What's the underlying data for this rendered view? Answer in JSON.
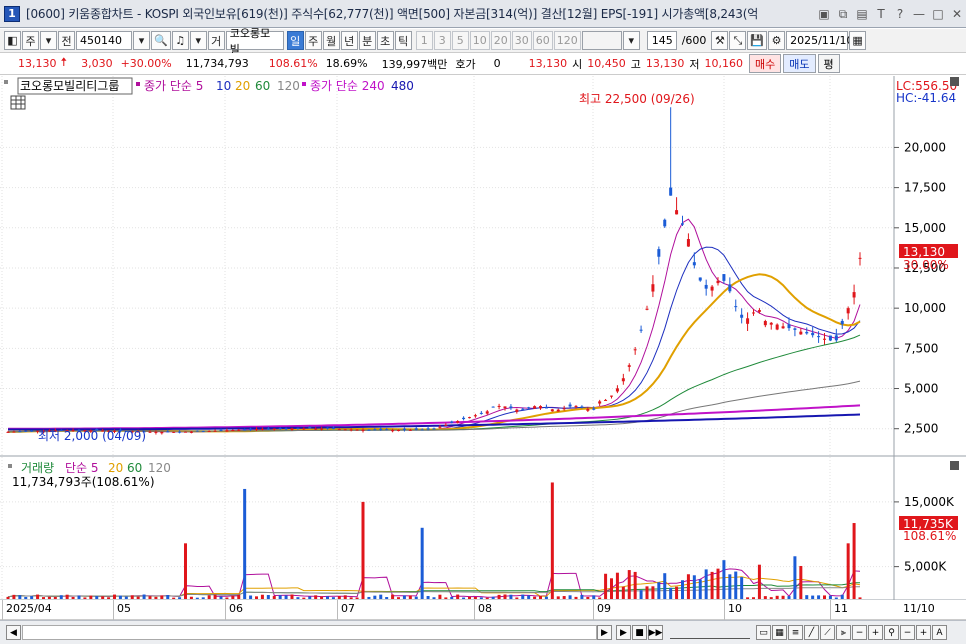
{
  "window": {
    "number": "1",
    "title": "[0600] 키움종합차트 - KOSPI 외국인보유[619(천)] 주식수[62,777(천)] 액면[500] 자본금[314(억)] 결산[12월] EPS[-191] 시가총액[8,243(억"
  },
  "toolbar": {
    "type_label": "주",
    "prev_label": "전",
    "code": "450140",
    "stock_name": "코오롱모빌",
    "name_prefix": "거",
    "periods": [
      "일",
      "주",
      "월",
      "년",
      "분",
      "초",
      "틱"
    ],
    "selected_period": "일",
    "numbers": [
      "1",
      "3",
      "5",
      "10",
      "20",
      "30",
      "60",
      "120"
    ],
    "count": "145",
    "count_total": "/600",
    "date": "2025/11/10"
  },
  "quote": {
    "price": "13,130",
    "change": "3,030",
    "change_pct": "+30.00%",
    "volume": "11,734,793",
    "vol_ratio": "108.61%",
    "turnover": "18.69%",
    "amount": "139,997백만",
    "hoga_label": "호가",
    "hoga_value": "0",
    "hoga_price": "13,130",
    "open_label": "시",
    "open": "10,450",
    "high_label": "고",
    "high": "13,130",
    "low_label": "저",
    "low": "10,160",
    "buy_label": "매수",
    "sell_label": "매도",
    "eval_label": "평"
  },
  "price_legend": {
    "name": "코오롱모빌리티그룹",
    "ma_label": "종가 단순 5",
    "ma_periods": [
      "10",
      "20",
      "60",
      "120"
    ],
    "ma2_label": "종가 단순 240",
    "ma2_period": "480",
    "colors": {
      "ma5": "#b0109c",
      "ma10": "#1d2fbf",
      "ma20": "#e0a000",
      "ma60": "#1f8a3a",
      "ma120": "#777777",
      "ma240": "#c012c8",
      "ma480": "#1616b0",
      "up": "#e0161b",
      "down": "#1b5cd6"
    }
  },
  "annotations": {
    "high_marker": "최고 22,500 (09/26)",
    "low_marker": "최저 2,000 (04/09)",
    "lc": "LC:556.50",
    "hc": "HC:-41.64",
    "last_price": "13,130",
    "last_pct": "30.00%"
  },
  "price_axis": [
    "20,000",
    "17,500",
    "15,000",
    "12,500",
    "10,000",
    "7,500",
    "5,000",
    "2,500"
  ],
  "volume_legend": {
    "label": "거래량",
    "ma_label": "단순 5",
    "periods": [
      "20",
      "60",
      "120"
    ],
    "current": "11,734,793주(108.61%)"
  },
  "volume_axis": [
    "15,000K",
    "5,000K"
  ],
  "volume_tags": {
    "value": "11,735K",
    "pct": "108.61%"
  },
  "x_axis": [
    "2025/04",
    "05",
    "06",
    "07",
    "08",
    "09",
    "10",
    "11",
    "11/10"
  ],
  "chart_data": {
    "type": "candlestick",
    "x": [
      "2025/04",
      "05",
      "06",
      "07",
      "08",
      "09",
      "10",
      "11"
    ],
    "price_range": [
      1300,
      23200
    ],
    "series": [
      {
        "name": "일봉",
        "high": 22500,
        "high_date": "09/26",
        "low": 2000,
        "low_date": "04/09",
        "last": 13130
      }
    ],
    "volume_range": [
      0,
      19000000
    ]
  }
}
